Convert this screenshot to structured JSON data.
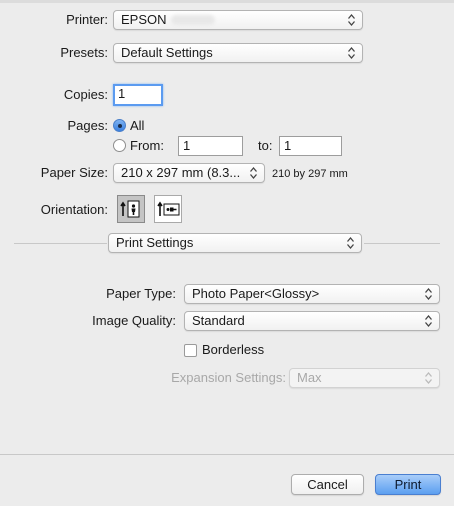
{
  "printer": {
    "label": "Printer:",
    "value": "EPSON"
  },
  "presets": {
    "label": "Presets:",
    "value": "Default Settings"
  },
  "copies": {
    "label": "Copies:",
    "value": "1"
  },
  "pages": {
    "label": "Pages:",
    "all_label": "All",
    "from_label": "From:",
    "from_value": "1",
    "to_label": "to:",
    "to_value": "1",
    "selected": "All"
  },
  "paper_size": {
    "label": "Paper Size:",
    "value": "210 x 297 mm (8.3...",
    "dimensions": "210 by 297 mm"
  },
  "orientation": {
    "label": "Orientation:",
    "selected": "portrait"
  },
  "section": {
    "value": "Print Settings"
  },
  "paper_type": {
    "label": "Paper Type:",
    "value": "Photo Paper<Glossy>"
  },
  "image_quality": {
    "label": "Image Quality:",
    "value": "Standard"
  },
  "borderless": {
    "label": "Borderless",
    "checked": false
  },
  "expansion": {
    "label": "Expansion Settings:",
    "value": "Max",
    "enabled": false
  },
  "buttons": {
    "cancel": "Cancel",
    "print": "Print"
  },
  "colors": {
    "window_bg": "#ececec",
    "accent": "#5c9ff0",
    "focus_ring": "#5b9bf0"
  }
}
